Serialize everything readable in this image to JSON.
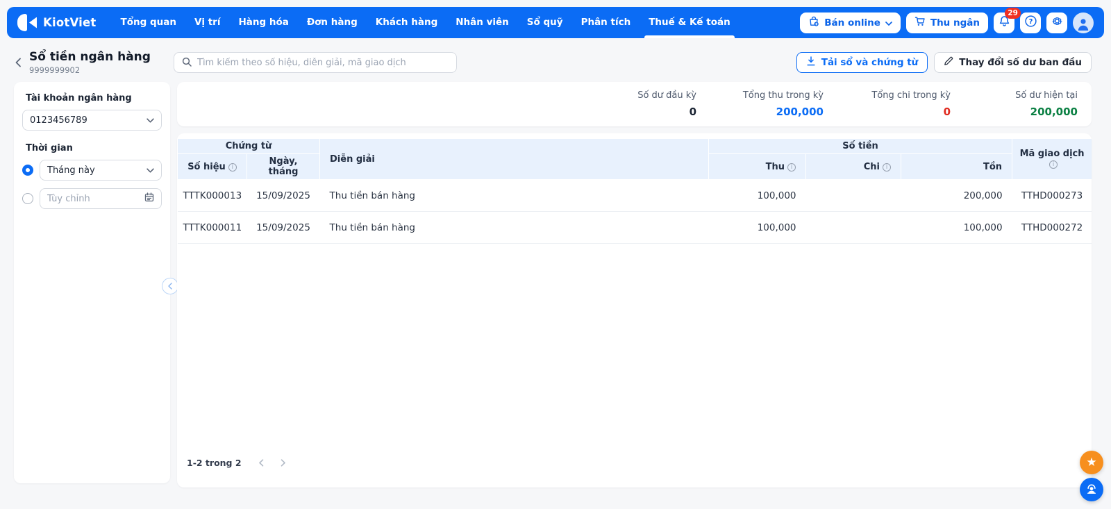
{
  "navbar": {
    "brand": "KiotViet",
    "items": [
      {
        "label": "Tổng quan",
        "active": false
      },
      {
        "label": "Vị trí",
        "active": false
      },
      {
        "label": "Hàng hóa",
        "active": false
      },
      {
        "label": "Đơn hàng",
        "active": false
      },
      {
        "label": "Khách hàng",
        "active": false
      },
      {
        "label": "Nhân viên",
        "active": false
      },
      {
        "label": "Sổ quỹ",
        "active": false
      },
      {
        "label": "Phân tích",
        "active": false
      },
      {
        "label": "Thuế & Kế toán",
        "active": true
      }
    ],
    "right": {
      "ban_online_label": "Bán online",
      "thu_ngan_label": "Thu ngân",
      "notification_count": "29"
    }
  },
  "header": {
    "title": "Sổ tiền ngân hàng",
    "subtitle": "9999999902",
    "search_placeholder": "Tìm kiếm theo số hiệu, diễn giải, mã giao dịch",
    "download_button": "Tải sổ và chứng từ",
    "change_balance_button": "Thay đổi số dư ban đầu"
  },
  "sidebar": {
    "account_label": "Tài khoản ngân hàng",
    "account_value": "0123456789",
    "time_label": "Thời gian",
    "time_preset_value": "Tháng này",
    "custom_placeholder": "Tùy chỉnh"
  },
  "summary": {
    "items": [
      {
        "label": "Số dư đầu kỳ",
        "value": "0",
        "color": "#1b2433"
      },
      {
        "label": "Tổng thu trong kỳ",
        "value": "200,000",
        "color": "#0b6cf5"
      },
      {
        "label": "Tổng chi trong kỳ",
        "value": "0",
        "color": "#e02b20"
      },
      {
        "label": "Số dư hiện tại",
        "value": "200,000",
        "color": "#0b8043"
      }
    ]
  },
  "table": {
    "group_headers": {
      "chung_tu": "Chứng từ",
      "so_tien": "Số tiền"
    },
    "columns": {
      "so_hieu": "Số hiệu",
      "ngay_thang": "Ngày, tháng",
      "dien_giai": "Diễn giải",
      "thu": "Thu",
      "chi": "Chi",
      "ton": "Tồn",
      "ma_giao_dich": "Mã giao dịch"
    },
    "rows": [
      {
        "so_hieu": "TTTK000013",
        "ngay_thang": "15/09/2025",
        "dien_giai": "Thu tiền bán hàng",
        "thu": "100,000",
        "chi": "",
        "ton": "200,000",
        "ma_giao_dich": "TTHD000273"
      },
      {
        "so_hieu": "TTTK000011",
        "ngay_thang": "15/09/2025",
        "dien_giai": "Thu tiền bán hàng",
        "thu": "100,000",
        "chi": "",
        "ton": "100,000",
        "ma_giao_dich": "TTHD000272"
      }
    ],
    "pagination_label": "1-2 trong 2"
  },
  "icons": {
    "info_glyph": "i",
    "help_glyph": "?",
    "star_glyph": "★"
  },
  "colors": {
    "accent_blue": "#0b6cf5",
    "badge_red": "#f03022",
    "fab_orange": "#f78f1e",
    "header_blue_bg": "#e8f1fd"
  }
}
